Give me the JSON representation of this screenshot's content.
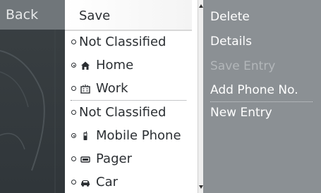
{
  "left": {
    "back_label": "Back"
  },
  "list": {
    "save_label": "Save",
    "rows": [
      {
        "label": "Not Classified",
        "icon": "none",
        "selected": false
      },
      {
        "label": "Home",
        "icon": "home-icon",
        "selected": true
      },
      {
        "label": "Work",
        "icon": "work-icon",
        "selected": false
      },
      {
        "label": "Not Classified",
        "icon": "none",
        "selected": false
      },
      {
        "label": "Mobile Phone",
        "icon": "mobile-phone-icon",
        "selected": true
      },
      {
        "label": "Pager",
        "icon": "pager-icon",
        "selected": false
      },
      {
        "label": "Car",
        "icon": "car-icon",
        "selected": false
      }
    ]
  },
  "menu": {
    "items": [
      {
        "label": "Delete",
        "enabled": true
      },
      {
        "label": "Details",
        "enabled": true
      },
      {
        "label": "Save Entry",
        "enabled": false
      },
      {
        "label": "Add Phone No.",
        "enabled": true
      },
      {
        "label": "New Entry",
        "enabled": true
      }
    ]
  },
  "colors": {
    "right_panel": "#8b9094",
    "left_header": "#70767a",
    "list_background": "#ffffff",
    "text_dark": "#2b2f33",
    "menu_text": "#ffffff",
    "menu_disabled": "#b3b7ba"
  }
}
